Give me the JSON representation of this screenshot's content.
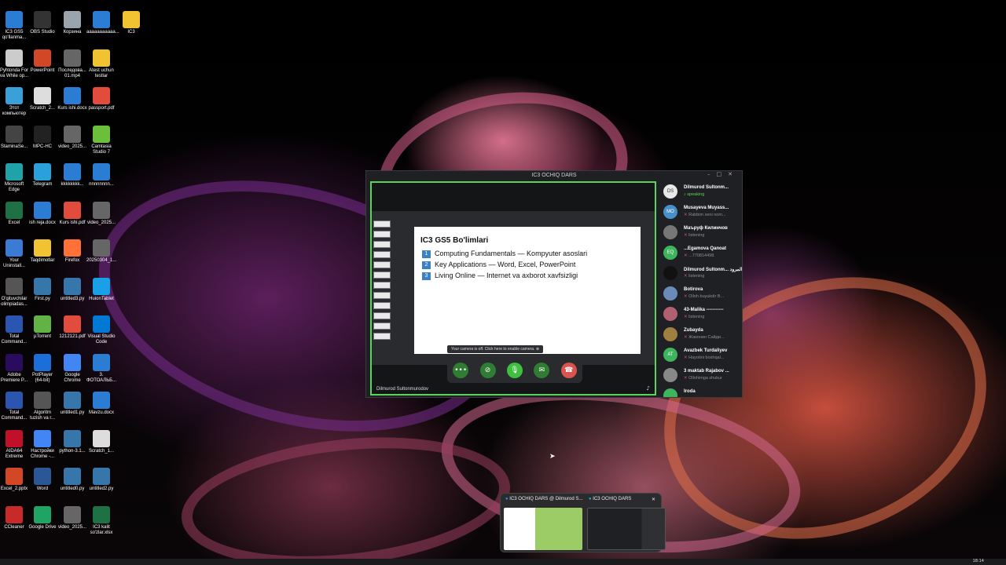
{
  "desktop": {
    "icons": [
      {
        "label": "IC3 GS5 qo'llanma...",
        "icon": "word-doc-icon",
        "color": "#2b7cd3"
      },
      {
        "label": "OBS Studio",
        "icon": "obs-icon",
        "color": "#333333"
      },
      {
        "label": "Корзина",
        "icon": "recycle-bin-icon",
        "color": "#9aa4ad"
      },
      {
        "label": "ааааааааааа...",
        "icon": "word-doc-icon",
        "color": "#2b7cd3"
      },
      {
        "label": "IC3",
        "icon": "folder-icon",
        "color": "#f1c232"
      },
      {
        "label": "Pyhtonda For va While op...",
        "icon": "file-icon",
        "color": "#cccccc"
      },
      {
        "label": "PowerPoint",
        "icon": "powerpoint-icon",
        "color": "#d24726"
      },
      {
        "label": "Последова... 01.mp4",
        "icon": "video-file-icon",
        "color": "#666666"
      },
      {
        "label": "Atest uchun testlar",
        "icon": "folder-icon",
        "color": "#f1c232"
      },
      {
        "label": "Этот компьютер",
        "icon": "computer-icon",
        "color": "#3aa0d8"
      },
      {
        "label": "Scratch_2...",
        "icon": "file-icon",
        "color": "#dddddd"
      },
      {
        "label": "Kurs ishi.docx",
        "icon": "word-doc-icon",
        "color": "#2b7cd3"
      },
      {
        "label": "passport.pdf",
        "icon": "pdf-icon",
        "color": "#e24c3c"
      },
      {
        "label": "StaminaSe...",
        "icon": "app-icon",
        "color": "#444444"
      },
      {
        "label": "MPC-HC",
        "icon": "media-player-icon",
        "color": "#222222"
      },
      {
        "label": "video_2025...",
        "icon": "video-file-icon",
        "color": "#666666"
      },
      {
        "label": "Camtasia Studio 7",
        "icon": "camtasia-icon",
        "color": "#6bbf3a"
      },
      {
        "label": "Microsoft Edge",
        "icon": "edge-icon",
        "color": "#1fa3a8"
      },
      {
        "label": "Telegram",
        "icon": "telegram-icon",
        "color": "#2aa1da"
      },
      {
        "label": "kkkkkkkk...",
        "icon": "word-doc-icon",
        "color": "#2b7cd3"
      },
      {
        "label": "nnnnnnnn...",
        "icon": "word-doc-icon",
        "color": "#2b7cd3"
      },
      {
        "label": "Excel",
        "icon": "excel-icon",
        "color": "#1e7145"
      },
      {
        "label": "ish reja.docx",
        "icon": "word-doc-icon",
        "color": "#2b7cd3"
      },
      {
        "label": "Kurs ishi.pdf",
        "icon": "pdf-icon",
        "color": "#e24c3c"
      },
      {
        "label": "video_2025...",
        "icon": "video-file-icon",
        "color": "#666666"
      },
      {
        "label": "Your Uninstall...",
        "icon": "uninstaller-icon",
        "color": "#3a7bd5"
      },
      {
        "label": "Taqdimotlar",
        "icon": "folder-icon",
        "color": "#f1c232"
      },
      {
        "label": "Firefox",
        "icon": "firefox-icon",
        "color": "#ff7139"
      },
      {
        "label": "20250304_1...",
        "icon": "video-file-icon",
        "color": "#666666"
      },
      {
        "label": "O'qituvchilar olimpiadas...",
        "icon": "app-icon",
        "color": "#555555"
      },
      {
        "label": "First.py",
        "icon": "python-icon",
        "color": "#3776ab"
      },
      {
        "label": "untitled3.py",
        "icon": "python-icon",
        "color": "#3776ab"
      },
      {
        "label": "HuionTablet",
        "icon": "tablet-icon",
        "color": "#1aa0e6"
      },
      {
        "label": "Total Command...",
        "icon": "total-commander-icon",
        "color": "#2a55b0"
      },
      {
        "label": "µTorrent",
        "icon": "utorrent-icon",
        "color": "#62b246"
      },
      {
        "label": "1212121.pdf",
        "icon": "pdf-icon",
        "color": "#e24c3c"
      },
      {
        "label": "Visual Studio Code",
        "icon": "vscode-icon",
        "color": "#0078d4"
      },
      {
        "label": "Adobe Premiere P...",
        "icon": "premiere-icon",
        "color": "#2a0c5e"
      },
      {
        "label": "PotPlayer (64-bit)",
        "icon": "potplayer-icon",
        "color": "#1c6fd8"
      },
      {
        "label": "Google Chrome",
        "icon": "chrome-icon",
        "color": "#4285f4"
      },
      {
        "label": "3. ФОТОАЛЬБ...",
        "icon": "word-doc-icon",
        "color": "#2b7cd3"
      },
      {
        "label": "Total Command...",
        "icon": "total-commander-icon",
        "color": "#2a55b0"
      },
      {
        "label": "Algoritm tuzish va r...",
        "icon": "app-icon",
        "color": "#555555"
      },
      {
        "label": "untitled1.py",
        "icon": "python-icon",
        "color": "#3776ab"
      },
      {
        "label": "Mavzu.docx",
        "icon": "word-doc-icon",
        "color": "#2b7cd3"
      },
      {
        "label": "AIDA64 Extreme",
        "icon": "aida64-icon",
        "color": "#c0102a"
      },
      {
        "label": "Настройки Chrome -...",
        "icon": "chrome-icon",
        "color": "#4285f4"
      },
      {
        "label": "python-3.1...",
        "icon": "python-icon",
        "color": "#3776ab"
      },
      {
        "label": "Scratch_1...",
        "icon": "file-icon",
        "color": "#dddddd"
      },
      {
        "label": "Excel_2.pptx",
        "icon": "powerpoint-icon",
        "color": "#d24726"
      },
      {
        "label": "Word",
        "icon": "word-icon",
        "color": "#2b5797"
      },
      {
        "label": "untitled0.py",
        "icon": "python-icon",
        "color": "#3776ab"
      },
      {
        "label": "untitled2.py",
        "icon": "python-icon",
        "color": "#3776ab"
      },
      {
        "label": "CCleaner",
        "icon": "ccleaner-icon",
        "color": "#c82a2a"
      },
      {
        "label": "Google Drive",
        "icon": "google-drive-icon",
        "color": "#1fa463"
      },
      {
        "label": "video_2025...",
        "icon": "video-file-icon",
        "color": "#666666"
      },
      {
        "label": "IC3 kalit so'zlar.xlsx",
        "icon": "excel-icon",
        "color": "#1e7145"
      }
    ]
  },
  "meeting": {
    "window_title": "IC3 OCHIQ DARS",
    "slide": {
      "title": "IC3 GS5 Bo'limlari",
      "items": [
        {
          "num": "1",
          "text": "Computing Fundamentals — Kompyuter asoslari"
        },
        {
          "num": "2",
          "text": "Key Applications — Word, Excel, PowerPoint"
        },
        {
          "num": "3",
          "text": "Living Online — Internet va axborot xavfsizligi"
        }
      ]
    },
    "camera_toast": "Your camera is off. Click here to enable camera.",
    "speaker_name": "Dilmurod Sultonmurodov",
    "participants": [
      {
        "initials": "DS",
        "name": "Dilmurod Sultonm...",
        "status": "speaking",
        "color": "#e8e8e8"
      },
      {
        "initials": "MO",
        "name": "Musayeva Muyass...",
        "status": "Rabbim seni nom...",
        "color": "#4a90c8"
      },
      {
        "initials": "",
        "name": "Маъруф Килинчов",
        "status": "listening",
        "color": "#777777"
      },
      {
        "initials": "EQ",
        "name": "...Egamova Qanoat",
        "status": "...770814498.",
        "color": "#3fb45f"
      },
      {
        "initials": "",
        "name": "Dilmurod Sultonm... المرود",
        "status": "listening",
        "color": "#111111"
      },
      {
        "initials": "",
        "name": "Botirova",
        "status": "Olloh buyukdir B...",
        "color": "#6a8bb8"
      },
      {
        "initials": "",
        "name": "43-Malika -----------",
        "status": "listening",
        "color": "#b06070"
      },
      {
        "initials": "",
        "name": "Zubayda",
        "status": "Жаконин Сайди...",
        "color": "#a08040"
      },
      {
        "initials": "AT",
        "name": "Avazbek Turdaliyev",
        "status": "Hayotini boshqal...",
        "color": "#3fb45f"
      },
      {
        "initials": "",
        "name": "3 maktab Rajabov ...",
        "status": "Ollohimga shukur",
        "color": "#888888"
      },
      {
        "initials": "",
        "name": "Iroda",
        "status": "",
        "color": "#3fb45f"
      }
    ]
  },
  "taskbar_preview": {
    "item1": "IC3 OCHIQ DARS @ Dilmurod S...",
    "item2": "IC3 OCHIQ DARS"
  },
  "taskbar": {
    "clock": "18:14"
  }
}
